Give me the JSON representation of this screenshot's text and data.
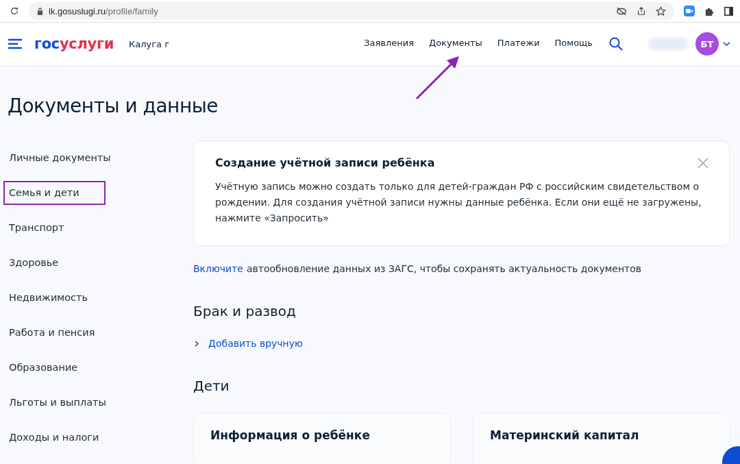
{
  "browser": {
    "url_host": "lk.gosuslugi.ru",
    "url_path": "/profile/family"
  },
  "header": {
    "logo": [
      "гос",
      "услуги"
    ],
    "region": "Калуга г",
    "nav": [
      {
        "label": "Заявления",
        "selected": false
      },
      {
        "label": "Документы",
        "selected": false
      },
      {
        "label": "Платежи",
        "selected": false
      },
      {
        "label": "Помощь",
        "selected": false
      }
    ],
    "avatar": "БТ"
  },
  "page_title": "Документы и данные",
  "sidebar": {
    "items": [
      {
        "label": "Личные документы",
        "selected": false
      },
      {
        "label": "Семья и дети",
        "selected": true
      },
      {
        "label": "Транспорт",
        "selected": false
      },
      {
        "label": "Здоровье",
        "selected": false
      },
      {
        "label": "Недвижимость",
        "selected": false
      },
      {
        "label": "Работа и пенсия",
        "selected": false
      },
      {
        "label": "Образование",
        "selected": false
      },
      {
        "label": "Льготы и выплаты",
        "selected": false
      },
      {
        "label": "Доходы и налоги",
        "selected": false
      }
    ]
  },
  "notice": {
    "title": "Создание учётной записи ребёнка",
    "text": "Учётную запись можно создать только для детей-граждан РФ с российским свидетельством о рождении. Для создания учётной записи нужны данные ребёнка. Если они ещё не загружены, нажмите «Запросить»"
  },
  "auto_update": {
    "link": "Включите",
    "text": "автообновление данных из ЗАГС, чтобы сохранять актуальность документов"
  },
  "marriage": {
    "title": "Брак и развод",
    "add_link": "Добавить вручную"
  },
  "children": {
    "title": "Дети",
    "cards": [
      "Информация о ребёнке",
      "Материнский капитал"
    ]
  }
}
